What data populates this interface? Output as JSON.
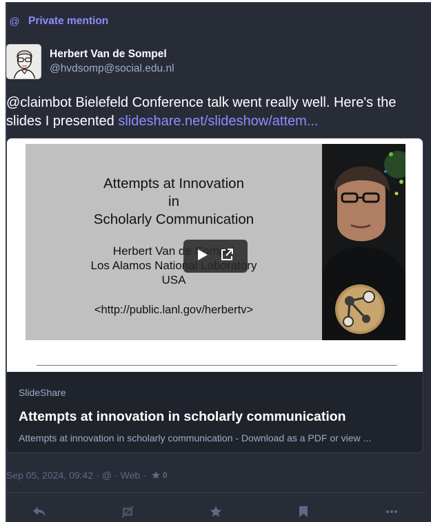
{
  "notification": {
    "icon": "at-icon",
    "at_symbol": "@",
    "label": "Private mention"
  },
  "author": {
    "display_name": "Herbert Van de Sompel",
    "handle": "@hvdsomp@social.edu.nl"
  },
  "status": {
    "mention": "@claimbot",
    "text": " Bielefeld Conference talk went really well. Here's the slides I presented ",
    "link_text": "slideshare.net/slideshow/attem..."
  },
  "card": {
    "slide": {
      "title_lines": [
        "Attempts at Innovation",
        "in",
        "Scholarly Communication"
      ],
      "body_lines": [
        "Herbert Van de Sompel",
        "Los Alamos National Laboratory",
        "USA"
      ],
      "url": "<http://public.lanl.gov/herbertv>"
    },
    "provider": "SlideShare",
    "title": "Attempts at innovation in scholarly communication",
    "description": "Attempts at innovation in scholarly communication - Download as a PDF or view ..."
  },
  "meta": {
    "timestamp": "Sep 05, 2024, 09:42",
    "separator": "·",
    "visibility_symbol": "@",
    "application": "Web",
    "favourites_count": "0"
  },
  "actions": [
    {
      "name": "reply",
      "icon": "reply-icon"
    },
    {
      "name": "boost",
      "icon": "boost-disabled-icon"
    },
    {
      "name": "favourite",
      "icon": "star-icon"
    },
    {
      "name": "bookmark",
      "icon": "bookmark-icon"
    },
    {
      "name": "more",
      "icon": "ellipsis-icon"
    }
  ],
  "colors": {
    "background": "#282c37",
    "accent": "#8c8dff",
    "muted": "#9baec8",
    "dim": "#606984"
  }
}
